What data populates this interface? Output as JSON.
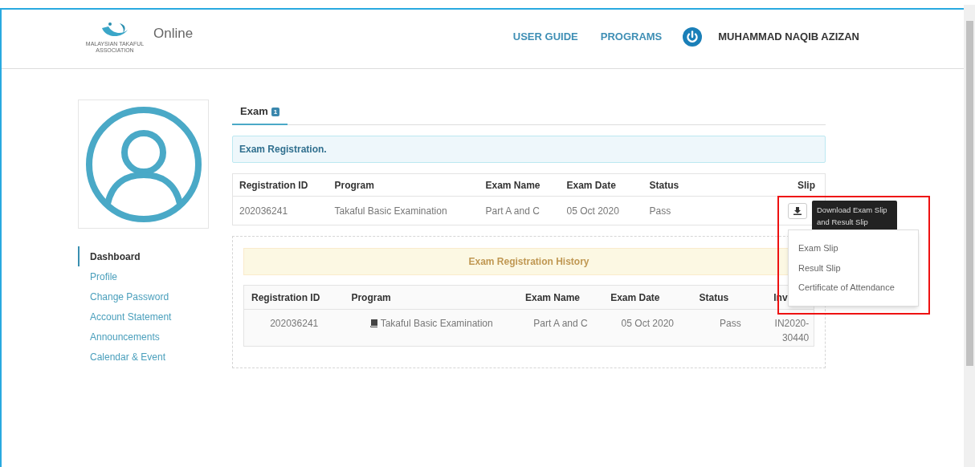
{
  "header": {
    "logo_caption": [
      "MALAYSIAN TAKAFUL",
      "ASSOCIATION"
    ],
    "brand": "Online",
    "nav": [
      "USER GUIDE",
      "PROGRAMS"
    ],
    "user_name": "MUHAMMAD NAQIB AZIZAN"
  },
  "sidebar": {
    "items": [
      {
        "label": "Dashboard",
        "selected": true
      },
      {
        "label": "Profile",
        "selected": false
      },
      {
        "label": "Change Password",
        "selected": false
      },
      {
        "label": "Account Statement",
        "selected": false
      },
      {
        "label": "Announcements",
        "selected": false
      },
      {
        "label": "Calendar & Event",
        "selected": false
      }
    ]
  },
  "tabs": [
    {
      "label": "Exam",
      "badge": "1",
      "selected": true
    }
  ],
  "alert": "Exam Registration.",
  "table": {
    "columns": [
      "Registration ID",
      "Program",
      "Exam Name",
      "Exam Date",
      "Status",
      "Slip"
    ],
    "rows": [
      {
        "cells": [
          "202036241",
          "Takaful Basic Examination",
          "Part A and C",
          "05 Oct 2020",
          "Pass"
        ]
      }
    ]
  },
  "tooltip": "Download Exam Slip and Result Slip",
  "dropdown": {
    "items": [
      "Exam Slip",
      "Result Slip",
      "Certificate of Attendance"
    ]
  },
  "history": {
    "title": "Exam Registration History",
    "columns": [
      "Registration ID",
      "Program",
      "Exam Name",
      "Exam Date",
      "Status",
      "Inv"
    ],
    "rows": [
      {
        "cells": [
          "202036241",
          "Takaful Basic Examination",
          "Part A and C",
          "05 Oct 2020",
          "Pass",
          "IN2020-30440"
        ]
      }
    ]
  }
}
